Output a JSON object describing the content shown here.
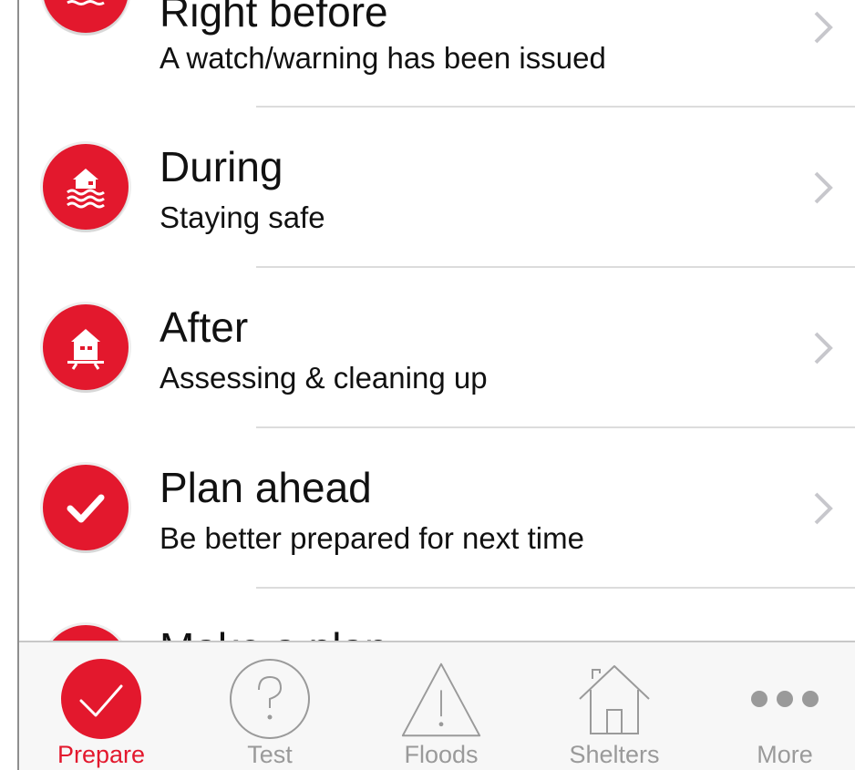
{
  "list": {
    "items": [
      {
        "title": "Right before",
        "subtitle": "A watch/warning has been issued",
        "icon": "house-flood-icon"
      },
      {
        "title": "During",
        "subtitle": "Staying safe",
        "icon": "house-flooding-icon"
      },
      {
        "title": "After",
        "subtitle": "Assessing & cleaning up",
        "icon": "house-after-flood-icon"
      },
      {
        "title": "Plan ahead",
        "subtitle": "Be better prepared for next time",
        "icon": "checkmark-icon"
      },
      {
        "title": "Make a plan",
        "subtitle": "",
        "icon": "plan-icon"
      }
    ]
  },
  "tabbar": {
    "tabs": [
      {
        "label": "Prepare",
        "icon": "checkmark-icon",
        "active": true
      },
      {
        "label": "Test",
        "icon": "question-icon",
        "active": false
      },
      {
        "label": "Floods",
        "icon": "warning-icon",
        "active": false
      },
      {
        "label": "Shelters",
        "icon": "house-icon",
        "active": false
      },
      {
        "label": "More",
        "icon": "more-dots-icon",
        "active": false
      }
    ]
  },
  "colors": {
    "accent": "#e3182d",
    "inactive": "#9a9a9a",
    "divider": "#dcdcdc",
    "tabbar_bg": "#f7f7f7"
  }
}
